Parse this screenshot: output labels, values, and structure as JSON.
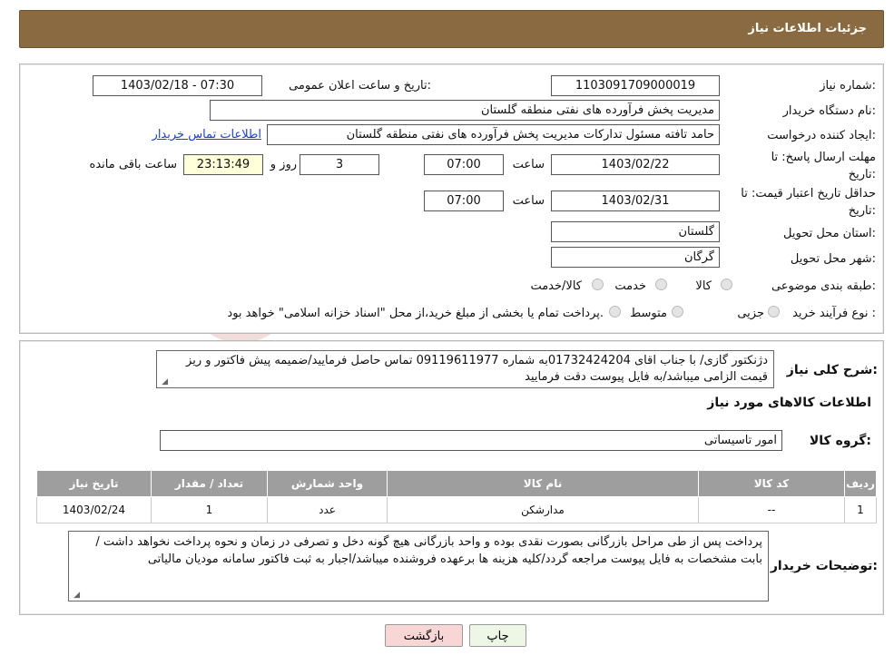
{
  "header": {
    "title": "جزئیات اطلاعات نیاز"
  },
  "form": {
    "need_number_label": "شماره نیاز:",
    "need_number": "1103091709000019",
    "announce_label": "تاریخ و ساعت اعلان عمومی:",
    "announce_value": "1403/02/18 - 07:30",
    "buyer_org_label": "نام دستگاه خریدار:",
    "buyer_org": "مدیریت پخش فرآورده های نفتی منطقه گلستان",
    "creator_label": "ایجاد کننده درخواست:",
    "creator": "حامد تافته مسئول تدارکات مدیریت پخش فرآورده های نفتی منطقه گلستان",
    "contact_link": "اطلاعات تماس خریدار",
    "deadline_label_1": "مهلت ارسال پاسخ: تا",
    "deadline_label_2": "تاریخ:",
    "deadline_date": "1403/02/22",
    "time_label": "ساعت",
    "deadline_time": "07:00",
    "days_value": "3",
    "days_label": "روز و",
    "remaining_time": "23:13:49",
    "remaining_label": "ساعت باقی مانده",
    "validity_label_1": "حداقل تاریخ اعتبار قیمت: تا",
    "validity_label_2": "تاریخ:",
    "validity_date": "1403/02/31",
    "validity_time_label": "ساعت",
    "validity_time": "07:00",
    "province_label": "استان محل تحویل:",
    "province": "گلستان",
    "city_label": "شهر محل تحویل:",
    "city": "گرگان",
    "category_label": "طبقه بندی موضوعی:",
    "category_options": [
      "کالا",
      "خدمت",
      "کالا/خدمت"
    ],
    "process_label": "نوع فرآیند خرید :",
    "process_options": [
      "جزیی",
      "متوسط"
    ],
    "process_note": "پرداخت تمام یا بخشی از مبلغ خرید،از محل \"اسناد خزانه اسلامی\" خواهد بود."
  },
  "description": {
    "label": "شرح کلی نیاز:",
    "text": "دژنکتور گازی/ با جناب اقای 01732424204به شماره 09119611977 تماس حاصل فرمایید/ضمیمه پیش فاکتور و ریز قیمت  الزامی میباشد/به فایل پیوست دقت فرمایید"
  },
  "goods": {
    "section_title": "اطلاعات کالاهای مورد نیاز",
    "group_label": "گروه کالا:",
    "group_value": "امور تاسیساتی",
    "columns": [
      "ردیف",
      "کد کالا",
      "نام کالا",
      "واحد شمارش",
      "تعداد / مقدار",
      "تاریخ نیاز"
    ],
    "rows": [
      [
        "1",
        "--",
        "مدارشکن",
        "عدد",
        "1",
        "1403/02/24"
      ]
    ]
  },
  "buyer_notes": {
    "label": "توضیحات خریدار:",
    "text": "پرداخت پس از طی مراحل بازرگانی بصورت نقدی بوده و واحد بازرگانی هیچ گونه دخل و تصرفی در زمان و نحوه پرداخت نخواهد داشت /بابت مشخصات به فایل پیوست مراجعه گردد/کلیه هزینه ها برعهده فروشنده میباشد/اجبار به ثبت فاکتور سامانه مودیان مالیاتی"
  },
  "buttons": {
    "print": "چاپ",
    "back": "بازگشت"
  },
  "colors": {
    "header": "#8a6a40",
    "link": "#1a3fd6",
    "back_button": "#f8d6d6",
    "print_button": "#eef7e6"
  }
}
